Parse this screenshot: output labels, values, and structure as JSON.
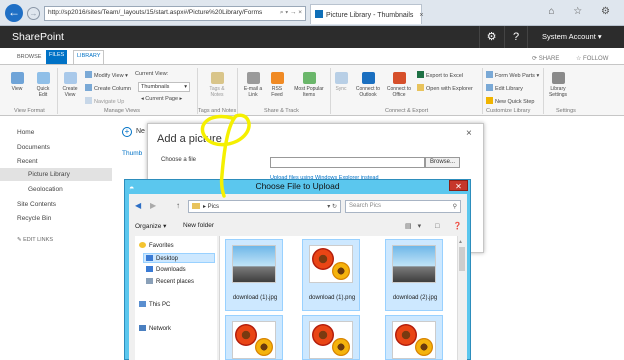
{
  "browser": {
    "address": "http://sp2016/sites/Team/_layouts/15/start.aspx#/Picture%20Library/Forms",
    "address_controls": "⌕ ▾ → ×",
    "tab_title": "Picture Library - Thumbnails",
    "tab_close": "×",
    "icons": "⌂ ☆ ⚙"
  },
  "suite": {
    "title": "SharePoint",
    "gear": "⚙",
    "help": "?",
    "account": "System Account ▾"
  },
  "ribbon": {
    "tabs": [
      "BROWSE",
      "FILES",
      "LIBRARY"
    ],
    "share": "⟳ SHARE",
    "follow": "☆ FOLLOW",
    "buttons": {
      "view": "View",
      "quick_edit": "Quick Edit",
      "create_view": "Create View",
      "modify_view": "Modify View ▾",
      "create_column": "Create Column",
      "navigate_up": "Navigate Up",
      "current_view_label": "Current View:",
      "current_view_value": "Thumbnails",
      "current_page": "◂ Current Page ▸",
      "tags_notes": "Tags & Notes",
      "email_link": "E-mail a Link",
      "rss_feed": "RSS Feed",
      "most_popular": "Most Popular Items",
      "sync": "Sync",
      "connect_outlook": "Connect to Outlook",
      "connect_office": "Connect to Office",
      "export_excel": "Export to Excel",
      "open_explorer": "Open with Explorer",
      "form_web_parts": "Form Web Parts ▾",
      "edit_library": "Edit Library",
      "new_quick_step": "New Quick Step",
      "library_settings": "Library Settings"
    },
    "groups": {
      "view_format": "View Format",
      "manage_views": "Manage Views",
      "tags_notes": "Tags and Notes",
      "share_track": "Share & Track",
      "connect_export": "Connect & Export",
      "customize_library": "Customize Library",
      "settings": "Settings"
    }
  },
  "leftnav": {
    "items": [
      "Home",
      "Documents",
      "Recent",
      "Picture Library",
      "Geolocation",
      "Site Contents",
      "Recycle Bin"
    ],
    "edit_links": "✎ EDIT LINKS"
  },
  "page": {
    "new_link": "Ne",
    "thumbnails_label": "Thumb"
  },
  "add_picture": {
    "title": "Add a picture",
    "close": "×",
    "choose_label": "Choose a file",
    "browse_button": "Browse...",
    "upload_hint": "Upload files using Windows Explorer instead"
  },
  "file_dialog": {
    "title": "Choose File to Upload",
    "close": "✕",
    "path": "▸ Pics",
    "path_controls": "▾ ↻",
    "search_placeholder": "Search Pics",
    "organize": "Organize ▾",
    "new_folder": "New folder",
    "view_controls": "▤▾ □ ❓",
    "tree": {
      "favorites": "Favorites",
      "desktop": "Desktop",
      "downloads": "Downloads",
      "recent_places": "Recent places",
      "this_pc": "This PC",
      "network": "Network"
    },
    "files": [
      {
        "name": "download (1).jpg",
        "thumb": "sky"
      },
      {
        "name": "download (1).png",
        "thumb": "flower"
      },
      {
        "name": "download (2).jpg",
        "thumb": "sky"
      },
      {
        "name": "",
        "thumb": "flower"
      },
      {
        "name": "",
        "thumb": "flower"
      },
      {
        "name": "",
        "thumb": "flower"
      }
    ]
  },
  "colors": {
    "suite_bar": "#2c2c2c",
    "accent": "#0072c6",
    "dialog_frame": "#5bc7ee",
    "annotation": "#f5f000"
  }
}
